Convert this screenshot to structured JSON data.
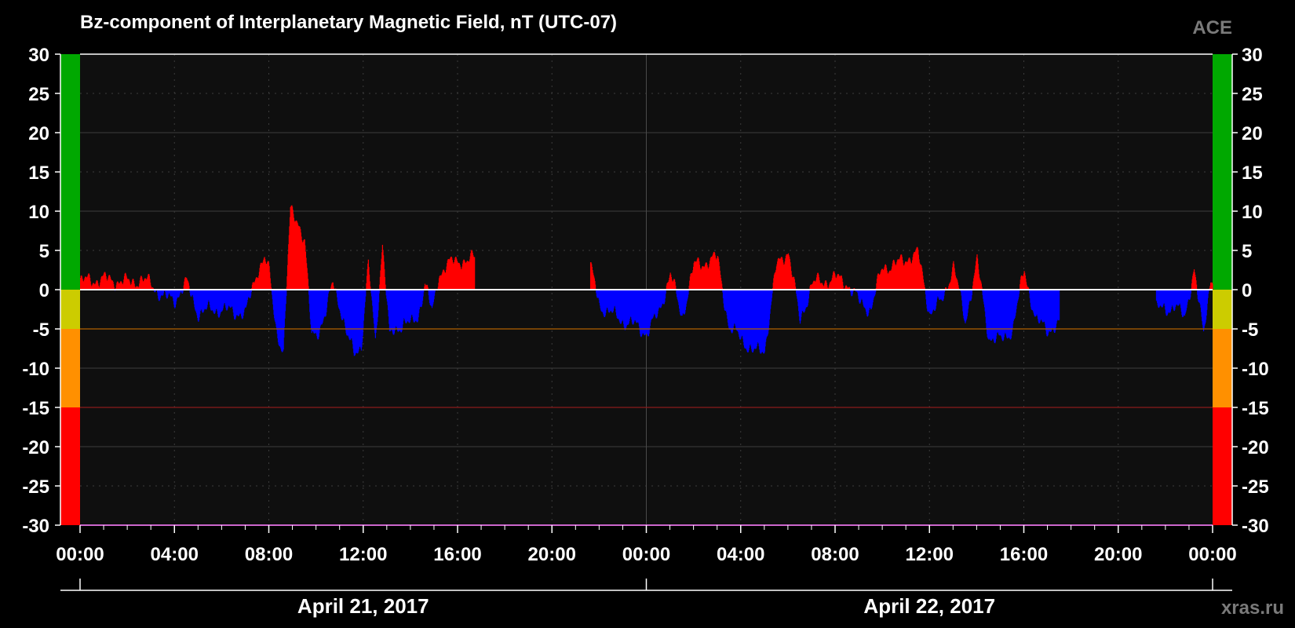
{
  "header": {
    "title": "Bz-component of Interplanetary Magnetic Field, nT (UTC-07)",
    "source": "ACE",
    "watermark": "xras.ru"
  },
  "colors": {
    "background": "#000000",
    "plot_background": "#0f0f0f",
    "positive": "#ff0000",
    "negative": "#0000ff",
    "zero_line": "#ffffff",
    "grid": "#3c3c3c",
    "threshold_minus5": "#b06000",
    "threshold_minus15": "#8a1a1a",
    "zone_colors": [
      "#00a800",
      "#cccc00",
      "#ff9000",
      "#ff0000"
    ]
  },
  "chart_data": {
    "type": "bar",
    "title": "Bz-component of Interplanetary Magnetic Field, nT (UTC-07)",
    "ylabel": "",
    "xlabel": "",
    "ylim": [
      -30,
      30
    ],
    "yticks": [
      30,
      25,
      20,
      15,
      10,
      5,
      0,
      -5,
      -10,
      -15,
      -20,
      -25,
      -30
    ],
    "x_range_hours": [
      0,
      48
    ],
    "xtick_labels": [
      "00:00",
      "04:00",
      "08:00",
      "12:00",
      "16:00",
      "20:00",
      "00:00",
      "04:00",
      "08:00",
      "12:00",
      "16:00",
      "20:00",
      "00:00"
    ],
    "date_labels": [
      "April 21, 2017",
      "April 22, 2017"
    ],
    "grid": true,
    "reference_lines": [
      0,
      -5,
      -15
    ],
    "zones": [
      {
        "from": 0,
        "to": 30,
        "color": "#00a800"
      },
      {
        "from": -5,
        "to": 0,
        "color": "#cccc00"
      },
      {
        "from": -15,
        "to": -5,
        "color": "#ff9000"
      },
      {
        "from": -30,
        "to": -15,
        "color": "#ff0000"
      }
    ],
    "gaps": [
      [
        17.0,
        21.5
      ],
      [
        17.7,
        21.5
      ],
      [
        42.0,
        45.5
      ]
    ],
    "series": [
      {
        "x": [
          0.0,
          0.5,
          1.0,
          1.5,
          2.0,
          2.5,
          3.0,
          3.5,
          4.0,
          4.5,
          5.0,
          5.5,
          6.0,
          6.5,
          7.0,
          7.5,
          7.8,
          8.0,
          8.3,
          8.6,
          8.9,
          9.2,
          9.5,
          9.8,
          10.1,
          10.4,
          10.7,
          11.0,
          11.3,
          11.6,
          11.9,
          12.2,
          12.5,
          12.8,
          13.1,
          13.4,
          13.7,
          14.0,
          14.3,
          14.6,
          14.9,
          15.2,
          15.5,
          15.8,
          16.1,
          16.4,
          16.7,
          21.6,
          22.0,
          22.5,
          23.0,
          23.5,
          24.0,
          24.5,
          25.0,
          25.5,
          26.0,
          26.5,
          27.0,
          27.5,
          28.0,
          28.5,
          29.0,
          29.5,
          30.0,
          30.5,
          31.0,
          31.5,
          32.0,
          32.5,
          33.0,
          33.5,
          34.0,
          34.5,
          35.0,
          35.5,
          36.0,
          36.5,
          37.0,
          37.5,
          38.0,
          38.5,
          39.0,
          39.5,
          40.0,
          40.5,
          41.0,
          41.5,
          45.6,
          46.0,
          46.4,
          46.8,
          47.2,
          47.6,
          47.9
        ],
        "values": [
          1.0,
          1.2,
          1.3,
          1.1,
          0.9,
          1.2,
          0.8,
          -1.0,
          -1.2,
          0.8,
          -3.0,
          -2.5,
          -2.5,
          -2.8,
          -3.0,
          2.5,
          4.0,
          2.0,
          -5.0,
          -8.0,
          10.0,
          9.0,
          6.0,
          -6.0,
          -5.0,
          -3.0,
          1.0,
          -2.0,
          -6.0,
          -8.0,
          -7.0,
          3.0,
          -6.5,
          6.0,
          -6.0,
          -5.0,
          -4.0,
          -4.5,
          -3.5,
          1.0,
          -3.0,
          2.0,
          3.0,
          3.5,
          3.8,
          3.5,
          4.0,
          3.0,
          -2.0,
          -3.0,
          -4.0,
          -4.5,
          -5.5,
          -3.0,
          2.0,
          -3.5,
          3.0,
          3.5,
          4.0,
          -5.0,
          -6.0,
          -8.0,
          -7.5,
          3.0,
          5.0,
          -4.0,
          0.8,
          1.0,
          1.5,
          0.8,
          -1.5,
          -2.5,
          3.0,
          3.0,
          4.0,
          4.5,
          -3.0,
          -1.5,
          3.0,
          -4.0,
          3.5,
          -6.0,
          -6.5,
          -5.0,
          2.5,
          -4.0,
          -5.0,
          -4.5,
          -2.0,
          -3.0,
          -1.5,
          -4.0,
          3.0,
          -6.0,
          1.5
        ]
      }
    ]
  }
}
